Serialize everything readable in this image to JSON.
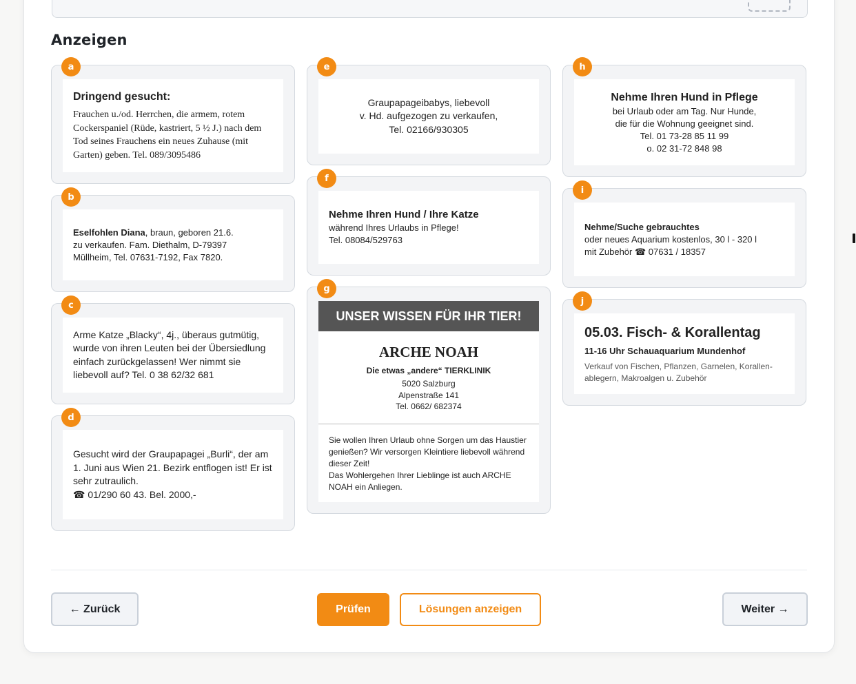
{
  "section_title": "Anzeigen",
  "ads": {
    "a": {
      "badge": "a",
      "title": "Dringend gesucht:",
      "body": "Frauchen u./od. Herrchen, die armem, rotem Cockerspaniel (Rüde, kastriert, 5 ½ J.) nach dem Tod seines Frauchens ein neues Zuhause (mit Garten) geben. Tel. 089/3095486"
    },
    "b": {
      "badge": "b",
      "title": "Eselfohlen Diana",
      "line1_rest": ", braun, geboren 21.6.",
      "line2": "zu verkaufen. Fam. Diethalm, D-79397",
      "line3": "Müllheim, Tel. 07631-7192, Fax 7820."
    },
    "c": {
      "badge": "c",
      "body": "Arme Katze „Blacky“, 4j., überaus gutmütig, wurde von ihren Leuten bei der Übersiedlung einfach zurückgelassen! Wer nimmt sie liebevoll auf? Tel. 0 38 62/32 681"
    },
    "d": {
      "badge": "d",
      "body": "Gesucht wird der Graupapagei „Burli“, der am 1. Juni aus Wien 21. Bezirk entflogen ist! Er ist sehr zutraulich.",
      "phone_icon": "☎",
      "phone_line": " 01/290 60 43. Bel. 2000,-"
    },
    "e": {
      "badge": "e",
      "line1": "Graupapageibabys, liebevoll",
      "line2": "v. Hd. aufgezogen zu verkaufen,",
      "line3": "Tel. 02166/930305"
    },
    "f": {
      "badge": "f",
      "title": "Nehme Ihren Hund / Ihre Katze",
      "line1": "während Ihres Urlaubs in Pflege!",
      "line2": "Tel. 08084/529763"
    },
    "g": {
      "badge": "g",
      "header": "UNSER WISSEN FÜR IHR TIER!",
      "name": "ARCHE NOAH",
      "subtitle": "Die etwas „andere“ TIERKLINIK",
      "line1": "5020 Salzburg",
      "line2": "Alpenstraße 141",
      "line3": "Tel. 0662/ 682374",
      "footer": "Sie wollen Ihren Urlaub ohne Sorgen um das Haustier genießen? Wir versorgen Kleintiere liebevoll während dieser Zeit!",
      "footer2": "Das Wohlergehen Ihrer Lieblinge ist auch ARCHE NOAH ein Anliegen."
    },
    "h": {
      "badge": "h",
      "title": "Nehme Ihren Hund in Pflege",
      "line1": "bei Urlaub oder am Tag. Nur Hunde,",
      "line2": "die für die Wohnung geeignet sind.",
      "line3": "Tel. 01 73-28 85 11 99",
      "line4": "o. 02 31-72 848 98"
    },
    "i": {
      "badge": "i",
      "title": "Nehme/Suche gebrauchtes",
      "line1": "oder neues Aquarium kostenlos, 30 l - 320 l",
      "line2_prefix": "mit Zubehör ",
      "phone_icon": "☎",
      "line2_phone": " 07631 / 18357"
    },
    "j": {
      "badge": "j",
      "title": "05.03. Fisch- & Korallentag",
      "subtitle": "11-16 Uhr Schauaquarium Mundenhof",
      "body": "Verkauf von Fischen, Pflanzen, Garnelen, Korallen-ablegern, Makroalgen u. Zubehör"
    }
  },
  "buttons": {
    "back": "← Zurück",
    "check": "Prüfen",
    "solutions": "Lösungen anzeigen",
    "next": "Weiter →"
  },
  "colors": {
    "accent": "#f28b14",
    "ad_header_bg": "#555555"
  }
}
